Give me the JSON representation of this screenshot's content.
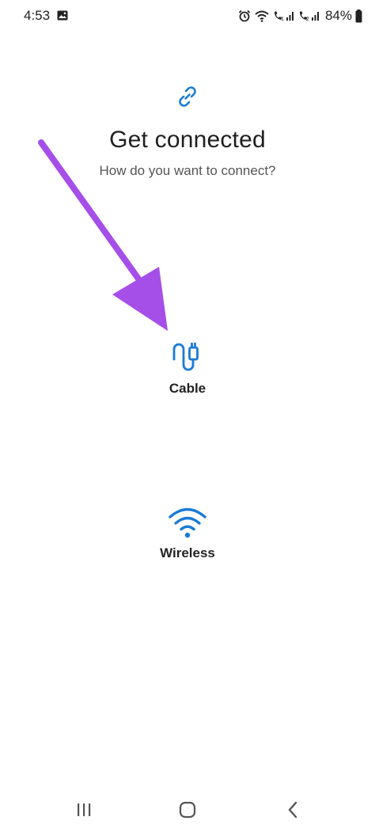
{
  "status_bar": {
    "time": "4:53",
    "battery": "84%"
  },
  "header": {
    "title": "Get connected",
    "subtitle": "How do you want to connect?"
  },
  "options": {
    "cable": {
      "label": "Cable",
      "icon": "cable-icon"
    },
    "wireless": {
      "label": "Wireless",
      "icon": "wifi-icon"
    }
  },
  "colors": {
    "accent": "#1a7bd6",
    "annotation_arrow": "#a64ee8"
  }
}
